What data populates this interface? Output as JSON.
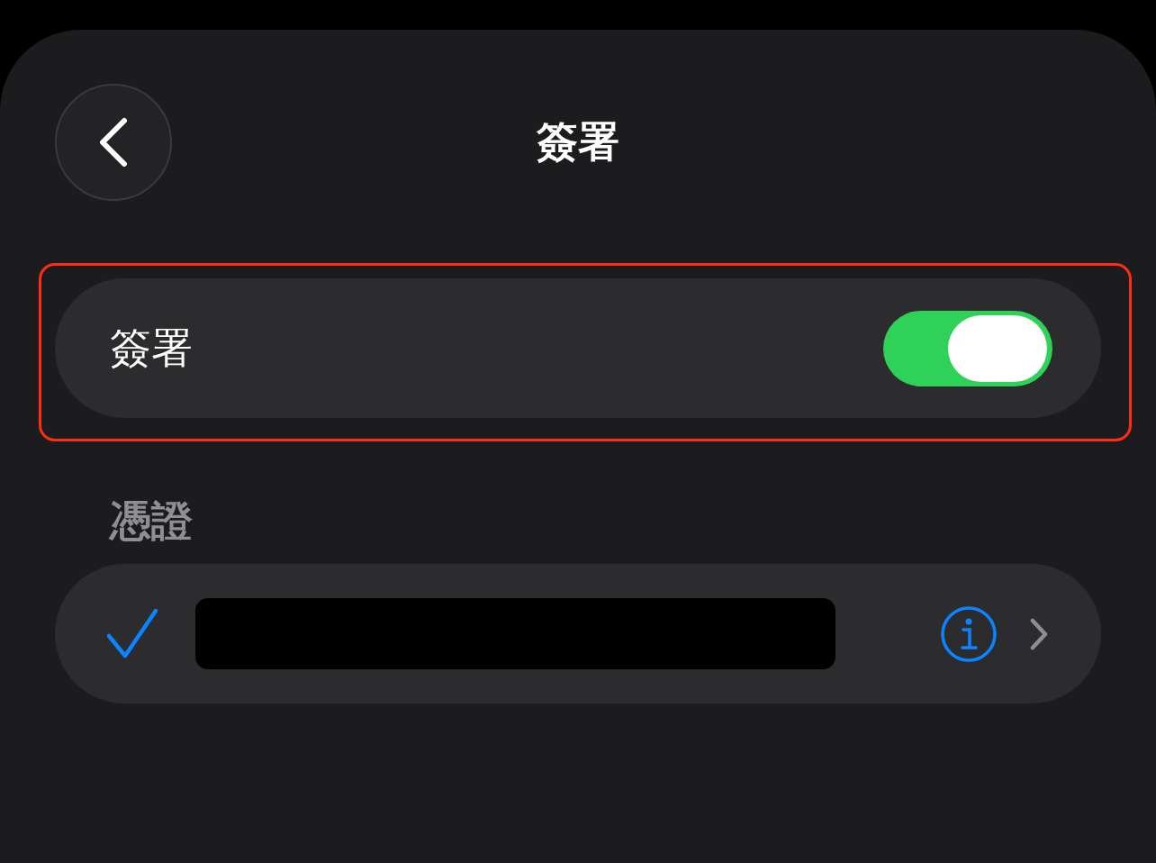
{
  "title": "簽署",
  "signing": {
    "label": "簽署",
    "on": true,
    "highlighted": true
  },
  "certificates": {
    "header": "憑證",
    "items": [
      {
        "checked": true,
        "redacted": true
      }
    ]
  }
}
